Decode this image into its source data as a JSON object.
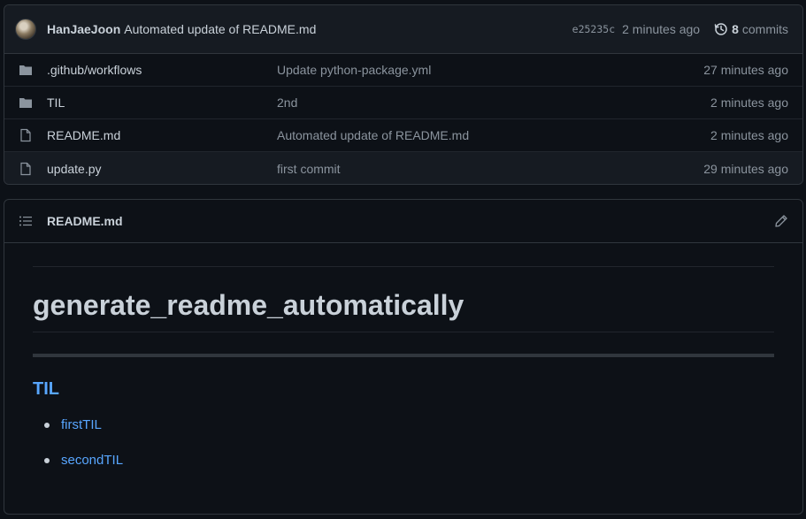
{
  "commit": {
    "author": "HanJaeJoon",
    "message": "Automated update of README.md",
    "sha": "e25235c",
    "time": "2 minutes ago",
    "commits_count": "8",
    "commits_label": "commits"
  },
  "files": [
    {
      "name_prefix": ".github/",
      "name_main": "workflows",
      "type": "folder",
      "message": "Update python-package.yml",
      "time": "27 minutes ago"
    },
    {
      "name_prefix": "",
      "name_main": "TIL",
      "type": "folder",
      "message": "2nd",
      "time": "2 minutes ago"
    },
    {
      "name_prefix": "",
      "name_main": "README.md",
      "type": "file",
      "message": "Automated update of README.md",
      "time": "2 minutes ago"
    },
    {
      "name_prefix": "",
      "name_main": "update.py",
      "type": "file",
      "message": "first commit",
      "time": "29 minutes ago"
    }
  ],
  "readme": {
    "title": "README.md",
    "heading": "generate_readme_automatically",
    "section_heading": "TIL",
    "items": [
      "firstTIL",
      "secondTIL"
    ]
  },
  "colors": {
    "background": "#0d1117",
    "link": "#58a6ff",
    "border": "#30363d"
  }
}
